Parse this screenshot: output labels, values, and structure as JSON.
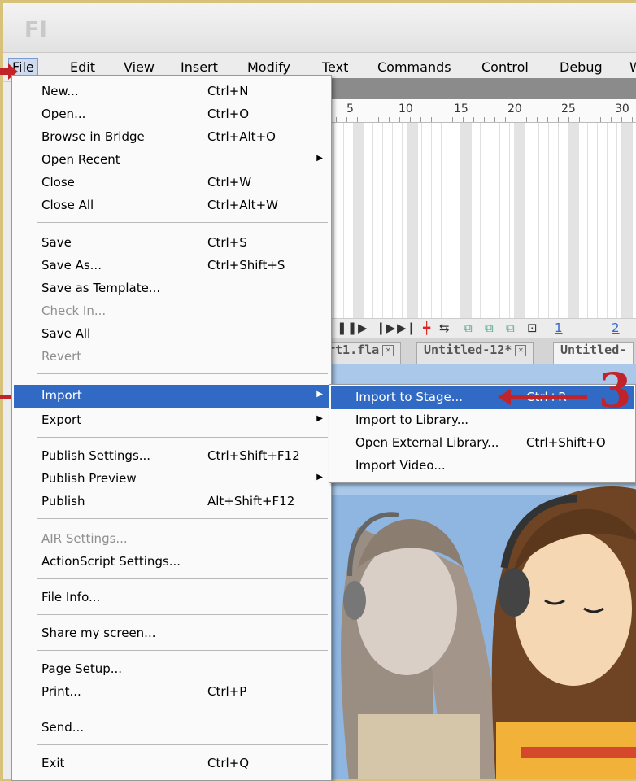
{
  "app": {
    "logo_text": "Fl"
  },
  "menubar": [
    {
      "label": "File",
      "active": true
    },
    {
      "label": "Edit"
    },
    {
      "label": "View"
    },
    {
      "label": "Insert"
    },
    {
      "label": "Modify"
    },
    {
      "label": "Text"
    },
    {
      "label": "Commands"
    },
    {
      "label": "Control"
    },
    {
      "label": "Debug"
    },
    {
      "label": "W"
    }
  ],
  "timeline": {
    "ruler": [
      "5",
      "10",
      "15",
      "20",
      "25",
      "30"
    ],
    "controls": {
      "frame_num_1": "1",
      "frame_num_2": "2"
    }
  },
  "doc_tabs": [
    {
      "label": "rt1.fla"
    },
    {
      "label": "Untitled-12*"
    },
    {
      "label": "Untitled-"
    }
  ],
  "file_menu": {
    "items": [
      {
        "label": "New...",
        "shortcut": "Ctrl+N"
      },
      {
        "label": "Open...",
        "shortcut": "Ctrl+O"
      },
      {
        "label": "Browse in Bridge",
        "shortcut": "Ctrl+Alt+O"
      },
      {
        "label": "Open Recent",
        "shortcut": "",
        "submenu": true
      },
      {
        "label": "Close",
        "shortcut": "Ctrl+W"
      },
      {
        "label": "Close All",
        "shortcut": "Ctrl+Alt+W"
      },
      {
        "label": "Save",
        "shortcut": "Ctrl+S"
      },
      {
        "label": "Save As...",
        "shortcut": "Ctrl+Shift+S"
      },
      {
        "label": "Save as Template...",
        "shortcut": ""
      },
      {
        "label": "Check In...",
        "shortcut": "",
        "disabled": true
      },
      {
        "label": "Save All",
        "shortcut": ""
      },
      {
        "label": "Revert",
        "shortcut": "",
        "disabled": true
      },
      {
        "label": "Import",
        "shortcut": "",
        "submenu": true,
        "highlighted": true
      },
      {
        "label": "Export",
        "shortcut": "",
        "submenu": true
      },
      {
        "label": "Publish Settings...",
        "shortcut": "Ctrl+Shift+F12"
      },
      {
        "label": "Publish Preview",
        "shortcut": "",
        "submenu": true
      },
      {
        "label": "Publish",
        "shortcut": "Alt+Shift+F12"
      },
      {
        "label": "AIR Settings...",
        "shortcut": "",
        "disabled": true
      },
      {
        "label": "ActionScript Settings...",
        "shortcut": ""
      },
      {
        "label": "File Info...",
        "shortcut": ""
      },
      {
        "label": "Share my screen...",
        "shortcut": ""
      },
      {
        "label": "Page Setup...",
        "shortcut": ""
      },
      {
        "label": "Print...",
        "shortcut": "Ctrl+P"
      },
      {
        "label": "Send...",
        "shortcut": ""
      },
      {
        "label": "Exit",
        "shortcut": "Ctrl+Q"
      }
    ]
  },
  "import_submenu": {
    "items": [
      {
        "label": "Import to Stage...",
        "shortcut": "Ctrl+R",
        "highlighted": true
      },
      {
        "label": "Import to Library...",
        "shortcut": ""
      },
      {
        "label": "Open External Library...",
        "shortcut": "Ctrl+Shift+O"
      },
      {
        "label": "Import Video...",
        "shortcut": ""
      }
    ]
  },
  "annotations": {
    "step_number": "3",
    "color": "#c0232a"
  },
  "colors": {
    "highlight": "#316ac5",
    "menu_bg": "#fafafa"
  }
}
